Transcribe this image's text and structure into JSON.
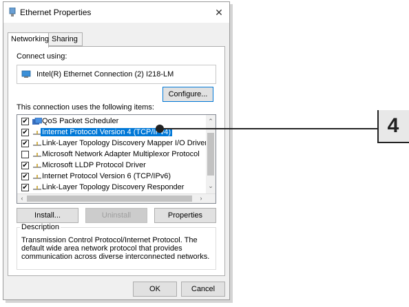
{
  "window": {
    "title": "Ethernet Properties",
    "close_glyph": "✕"
  },
  "tabs": [
    {
      "label": "Networking",
      "active": true
    },
    {
      "label": "Sharing",
      "active": false
    }
  ],
  "connect_using": {
    "label": "Connect using:",
    "adapter": "Intel(R) Ethernet Connection (2) I218-LM",
    "adapter_icon": "network-adapter-icon"
  },
  "buttons": {
    "configure": "Configure...",
    "install": "Install...",
    "uninstall": "Uninstall",
    "properties": "Properties",
    "ok": "OK",
    "cancel": "Cancel"
  },
  "items_label": "This connection uses the following items:",
  "items": [
    {
      "label": "QoS Packet Scheduler",
      "checked": true,
      "icon": "qos-icon",
      "selected": false
    },
    {
      "label": "Internet Protocol Version 4 (TCP/IPv4)",
      "checked": true,
      "icon": "protocol-icon",
      "selected": true
    },
    {
      "label": "Link-Layer Topology Discovery Mapper I/O Driver",
      "checked": true,
      "icon": "protocol-icon",
      "selected": false
    },
    {
      "label": "Microsoft Network Adapter Multiplexor Protocol",
      "checked": false,
      "icon": "protocol-icon",
      "selected": false
    },
    {
      "label": "Microsoft LLDP Protocol Driver",
      "checked": true,
      "icon": "protocol-icon",
      "selected": false
    },
    {
      "label": "Internet Protocol Version 6 (TCP/IPv6)",
      "checked": true,
      "icon": "protocol-icon",
      "selected": false
    },
    {
      "label": "Link-Layer Topology Discovery Responder",
      "checked": true,
      "icon": "protocol-icon",
      "selected": false
    }
  ],
  "description": {
    "legend": "Description",
    "text": "Transmission Control Protocol/Internet Protocol. The default wide area network protocol that provides communication across diverse interconnected networks."
  },
  "callout": {
    "number": "4"
  },
  "colors": {
    "selection": "#0078d7",
    "focus_border": "#0078d7"
  }
}
